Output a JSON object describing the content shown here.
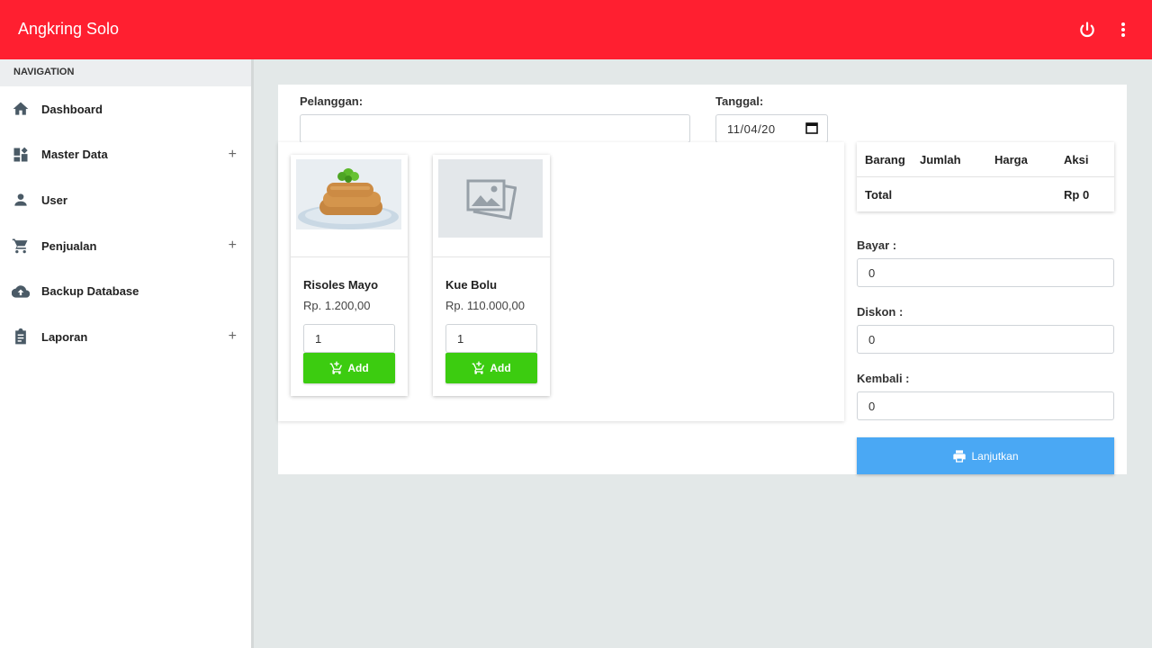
{
  "app": {
    "title": "Angkring Solo"
  },
  "topbar_icons": [
    "power-icon",
    "more-vert-icon"
  ],
  "nav": {
    "header": "NAVIGATION",
    "items": [
      {
        "label": "Dashboard",
        "icon": "home-icon",
        "expandable": false
      },
      {
        "label": "Master Data",
        "icon": "dashboard-icon",
        "expandable": true,
        "expand_symbol": "+"
      },
      {
        "label": "User",
        "icon": "user-icon",
        "expandable": false
      },
      {
        "label": "Penjualan",
        "icon": "cart-icon",
        "expandable": true,
        "expand_symbol": "+"
      },
      {
        "label": "Backup Database",
        "icon": "cloud-upload-icon",
        "expandable": false
      },
      {
        "label": "Laporan",
        "icon": "clipboard-icon",
        "expandable": true,
        "expand_symbol": "+"
      }
    ]
  },
  "form": {
    "customer_label": "Pelanggan:",
    "customer_value": "",
    "date_label": "Tanggal:",
    "date_value": "11/04/20"
  },
  "products": [
    {
      "name": "Risoles Mayo",
      "price": "Rp. 1.200,00",
      "qty": "1",
      "add_label": "Add",
      "image": "risoles-photo"
    },
    {
      "name": "Kue Bolu",
      "price": "Rp. 110.000,00",
      "qty": "1",
      "add_label": "Add",
      "image": "placeholder-image-icon"
    }
  ],
  "cart": {
    "headers": [
      "Barang",
      "Jumlah",
      "Harga",
      "Aksi"
    ],
    "total_label": "Total",
    "total_value": "Rp 0"
  },
  "payment": {
    "bayar_label": "Bayar :",
    "bayar_value": "0",
    "diskon_label": "Diskon :",
    "diskon_value": "0",
    "kembali_label": "Kembali :",
    "kembali_value": "0"
  },
  "submit": {
    "label": "Lanjutkan",
    "icon": "print-icon"
  },
  "colors": {
    "header": "#ff1f30",
    "add_button": "#3ccc10",
    "submit_button": "#4aa8f4"
  }
}
